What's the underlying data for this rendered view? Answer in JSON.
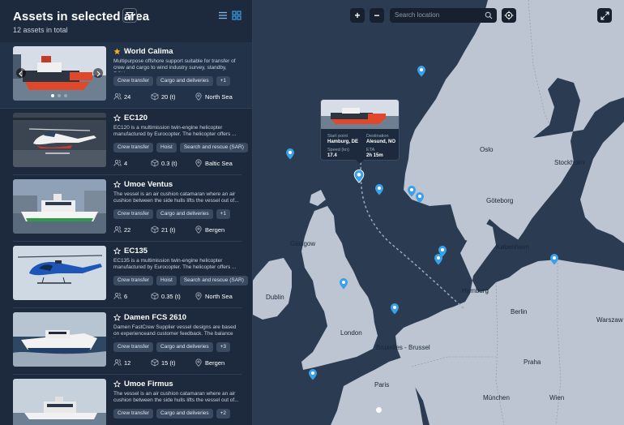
{
  "sidebar": {
    "title": "Assets in selected area",
    "subtitle": "12 assets in total"
  },
  "assets": [
    {
      "name": "World Calima",
      "favorite": true,
      "description": "Multipurpose offshore support suitable for transfer of crew and cargo to wind industry survey, standby, ROV...",
      "tags": [
        "Crew transfer",
        "Cargo and deliveries",
        "+1"
      ],
      "capacity": "24",
      "load": "20 (t)",
      "location": "North Sea"
    },
    {
      "name": "EC120",
      "favorite": false,
      "description": "EC120 is a multimission twin-engine helicopter manufactured by Eurocopter. The helicopter offers ...",
      "tags": [
        "Crew transfer",
        "Hoist",
        "Search and rescue (SAR)"
      ],
      "capacity": "4",
      "load": "0.3 (t)",
      "location": "Baltic Sea"
    },
    {
      "name": "Umoe Ventus",
      "favorite": false,
      "description": "The vessel is an air cushion catamaran where an air cushion between the side hulls lifts the vessel out of...",
      "tags": [
        "Crew transfer",
        "Cargo and deliveries",
        "+1"
      ],
      "capacity": "22",
      "load": "21 (t)",
      "location": "Bergen"
    },
    {
      "name": "EC135",
      "favorite": false,
      "description": "EC135 is a multimission twin-engine helicopter manufactured by Eurocopter. The helicopter offers ...",
      "tags": [
        "Crew transfer",
        "Hoist",
        "Search and rescue (SAR)"
      ],
      "capacity": "6",
      "load": "0.35 (t)",
      "location": "North Sea"
    },
    {
      "name": "Damen FCS 2610",
      "favorite": false,
      "description": "Damen FastCrew Supplier vessel designs are based on experienceand customer feedback. The balance betw...",
      "tags": [
        "Crew transfer",
        "Cargo and deliveries",
        "+3"
      ],
      "capacity": "12",
      "load": "15 (t)",
      "location": "Bergen"
    },
    {
      "name": "Umoe Firmus",
      "favorite": false,
      "description": "The vessel is an air cushion catamaran where an air cushion between the side hulls lifts the vessel out of...",
      "tags": [
        "Crew transfer",
        "Cargo and deliveries",
        "+2"
      ],
      "capacity": "",
      "load": "",
      "location": ""
    }
  ],
  "map": {
    "search_placeholder": "Search location",
    "zoom_in": "+",
    "zoom_out": "−",
    "labels": {
      "oslo": "Oslo",
      "stockholm": "Stockholm",
      "goteborg": "Göteborg",
      "kobenhavn": "København",
      "glasgow": "Glasgow",
      "dublin": "Dublin",
      "hamburg": "Hamburg",
      "berlin": "Berlin",
      "warszawa": "Warszaw",
      "london": "London",
      "bruxelles": "Bruxelles - Brussel",
      "paris": "Paris",
      "praha": "Praha",
      "munchen": "München",
      "wien": "Wien"
    },
    "popup": {
      "start_label": "Start point",
      "start_value": "Hamburg, DE",
      "dest_label": "Destination",
      "dest_value": "Alesund, NO",
      "speed_label": "Speed (kn)",
      "speed_value": "17.4",
      "eta_label": "ETA",
      "eta_value": "2h 15m"
    }
  },
  "colors": {
    "sidebar_bg": "#1d2a3d",
    "sea": "#2b3b52",
    "land": "#bcc5d1",
    "accent": "#3aa0e8",
    "star": "#f2b01e"
  }
}
